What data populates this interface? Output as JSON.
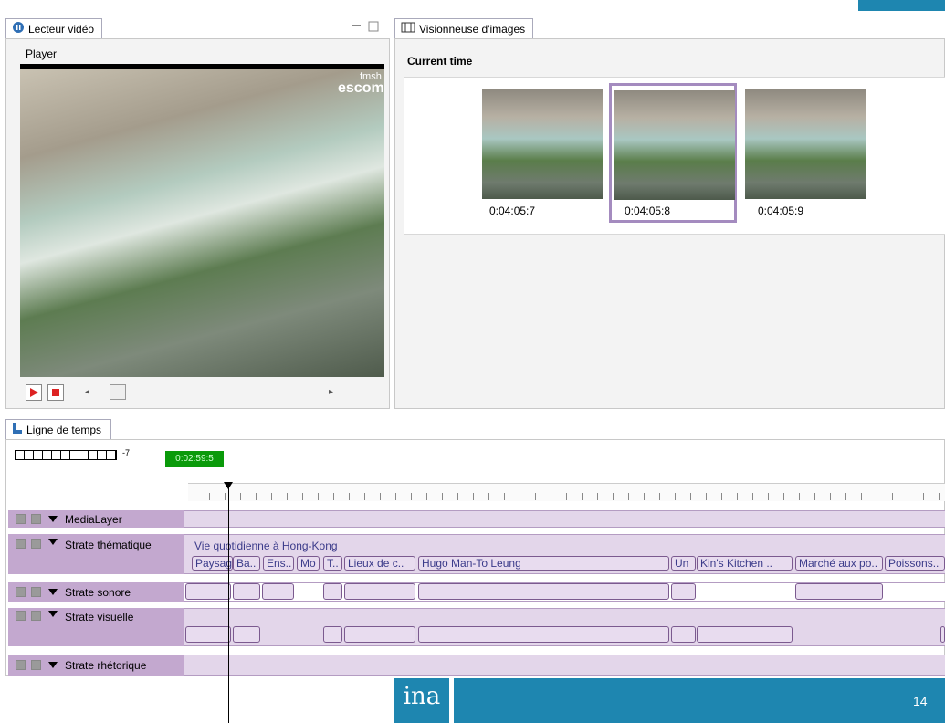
{
  "video_panel": {
    "tab_label": "Lecteur vidéo",
    "group_label": "Player",
    "watermark_top": "fmsh",
    "watermark_bottom": "escom"
  },
  "image_viewer": {
    "tab_label": "Visionneuse d'images",
    "section_label": "Current time",
    "frames": [
      {
        "time": "0:04:05:7"
      },
      {
        "time": "0:04:05:8",
        "selected": true
      },
      {
        "time": "0:04:05:9"
      }
    ]
  },
  "timeline": {
    "tab_label": "Ligne de temps",
    "zoom_value": "-7",
    "current_time": "0:02:59:5"
  },
  "layers": [
    {
      "label": "MediaLayer"
    },
    {
      "label": "Strate thématique",
      "title": "Vie quotidienne à Hong-Kong",
      "segments": [
        "Paysag",
        "Ba..",
        "Ens..",
        "Mo",
        "T..",
        "Lieux de c..",
        "Hugo Man-To Leung",
        "Un",
        "Kin's Kitchen ..",
        "Marché aux po..",
        "Poissons.."
      ]
    },
    {
      "label": "Strate sonore"
    },
    {
      "label": "Strate visuelle"
    },
    {
      "label": "Strate rhétorique"
    }
  ],
  "footer": {
    "logo": "ina",
    "page_number": "14"
  },
  "colors": {
    "accent_blue": "#1e86b0",
    "layer_purple": "#c3a8cf",
    "time_green": "#0a9a0a"
  }
}
